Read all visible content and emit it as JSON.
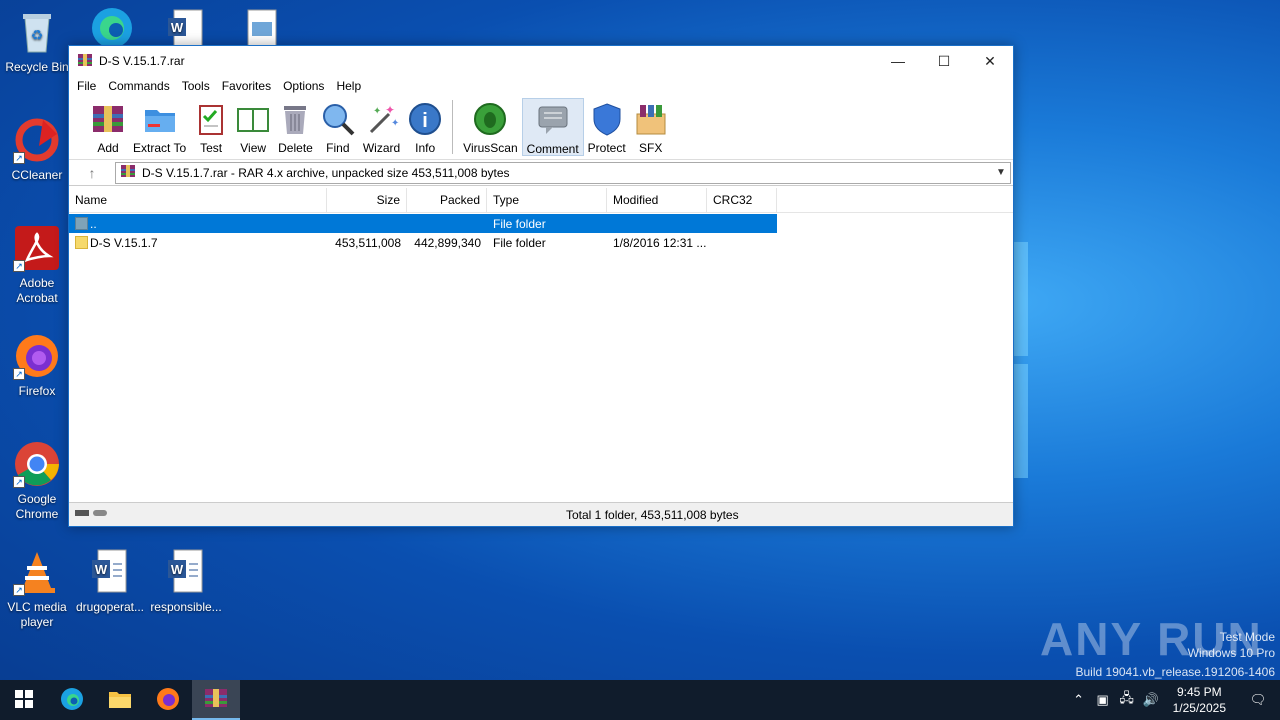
{
  "desktop": {
    "icons": [
      {
        "label": "Recycle Bin"
      },
      {
        "label": "CCleaner"
      },
      {
        "label": "Adobe Acrobat"
      },
      {
        "label": "Firefox"
      },
      {
        "label": "Google Chrome"
      },
      {
        "label": "VLC media player"
      },
      {
        "label": "drugoperat..."
      },
      {
        "label": "responsible..."
      }
    ],
    "watermark": {
      "brand": "ANY RUN",
      "line1": "Test Mode",
      "line2": "Windows 10 Pro",
      "line3": "Build 19041.vb_release.191206-1406"
    }
  },
  "window": {
    "title": "D-S V.15.1.7.rar",
    "menu": [
      "File",
      "Commands",
      "Tools",
      "Favorites",
      "Options",
      "Help"
    ],
    "toolbar": [
      "Add",
      "Extract To",
      "Test",
      "View",
      "Delete",
      "Find",
      "Wizard",
      "Info",
      "VirusScan",
      "Comment",
      "Protect",
      "SFX"
    ],
    "address": "D-S V.15.1.7.rar - RAR 4.x archive, unpacked size 453,511,008 bytes",
    "columns": {
      "name": "Name",
      "size": "Size",
      "packed": "Packed",
      "type": "Type",
      "modified": "Modified",
      "crc": "CRC32"
    },
    "rows": [
      {
        "name": "..",
        "size": "",
        "packed": "",
        "type": "File folder",
        "modified": "",
        "crc": ""
      },
      {
        "name": "D-S V.15.1.7",
        "size": "453,511,008",
        "packed": "442,899,340",
        "type": "File folder",
        "modified": "1/8/2016 12:31 ...",
        "crc": ""
      }
    ],
    "status": "Total 1 folder, 453,511,008 bytes"
  },
  "taskbar": {
    "time": "9:45 PM",
    "date": "1/25/2025"
  }
}
